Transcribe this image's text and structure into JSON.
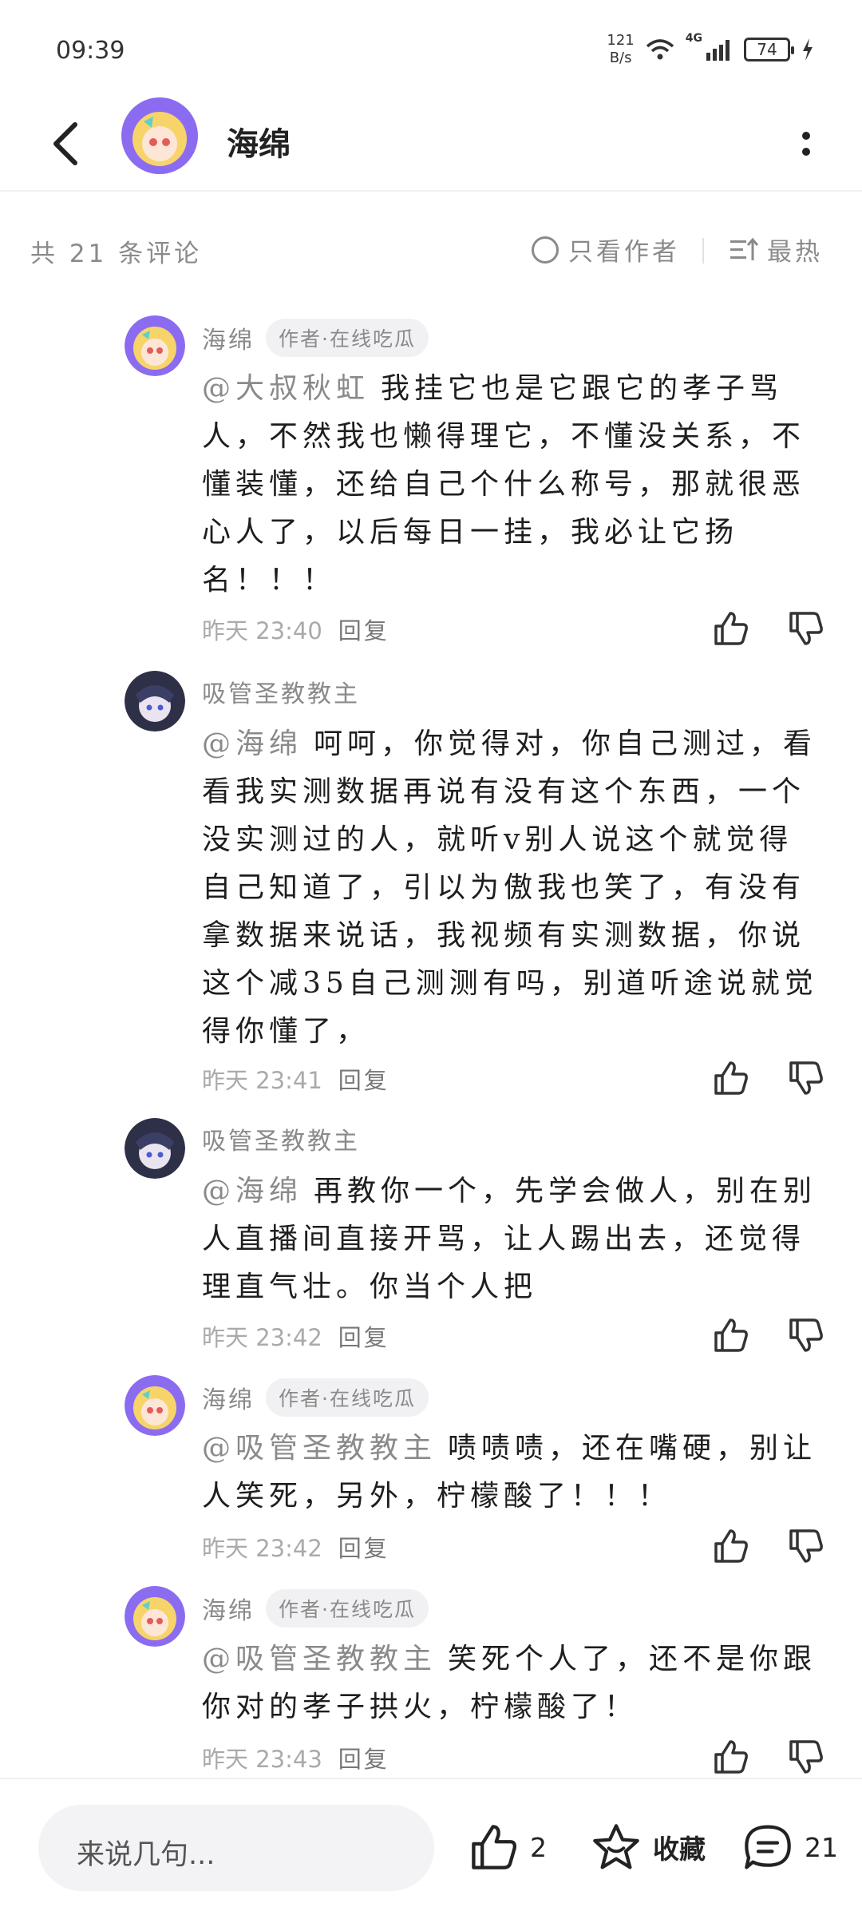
{
  "status": {
    "time": "09:39",
    "net_speed_top": "121",
    "net_speed_bottom": "B/s",
    "network": "4G",
    "battery": "74"
  },
  "header": {
    "title": "海绵"
  },
  "filter": {
    "count_label": "共 21 条评论",
    "author_only_label": "只看作者",
    "sort_label": "最热"
  },
  "comments": [
    {
      "author": "海绵",
      "tag": "作者·在线吃瓜",
      "mention": "@大叔秋虹",
      "text": "我挂它也是它跟它的孝子骂人，不然我也懒得理它，不懂没关系，不懂装懂，还给自己个什么称号，那就很恶心人了，以后每日一挂，我必让它扬名！！！",
      "time": "昨天 23:40",
      "reply_label": "回复"
    },
    {
      "author": "吸管圣教教主",
      "tag": "",
      "mention": "@海绵",
      "text": "呵呵，你觉得对，你自己测过，看看我实测数据再说有没有这个东西，一个没实测过的人，就听v别人说这个就觉得自己知道了，引以为傲我也笑了，有没有拿数据来说话，我视频有实测数据，你说这个减35自己测测有吗，别道听途说就觉得你懂了，",
      "time": "昨天 23:41",
      "reply_label": "回复"
    },
    {
      "author": "吸管圣教教主",
      "tag": "",
      "mention": "@海绵",
      "text": "再教你一个，先学会做人，别在别人直播间直接开骂，让人踢出去，还觉得理直气壮。你当个人把",
      "time": "昨天 23:42",
      "reply_label": "回复"
    },
    {
      "author": "海绵",
      "tag": "作者·在线吃瓜",
      "mention": "@吸管圣教教主",
      "text": "啧啧啧，还在嘴硬，别让人笑死，另外，柠檬酸了！！！",
      "time": "昨天 23:42",
      "reply_label": "回复"
    },
    {
      "author": "海绵",
      "tag": "作者·在线吃瓜",
      "mention": "@吸管圣教教主",
      "text": "笑死个人了，还不是你跟你对的孝子拱火，柠檬酸了！",
      "time": "昨天 23:43",
      "reply_label": "回复"
    }
  ],
  "bottom": {
    "input_placeholder": "来说几句...",
    "like_count": "2",
    "favorite_label": "收藏",
    "comment_count": "21"
  },
  "colors": {
    "avatar_ring_author": "#8b6cf0",
    "avatar_bg_other": "#2d3046",
    "muted_text": "#8a8a8a"
  }
}
